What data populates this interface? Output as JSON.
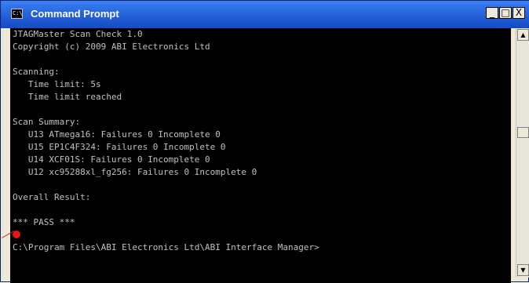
{
  "window": {
    "title": "Command Prompt",
    "icon_label": "C:\\",
    "buttons": {
      "minimize": "_",
      "maximize": "□",
      "close": "X"
    }
  },
  "console": {
    "lines": [
      "JTAGMaster Scan Check 1.0",
      "Copyright (c) 2009 ABI Electronics Ltd",
      "",
      "Scanning:",
      "   Time limit: 5s",
      "   Time limit reached",
      "",
      "Scan Summary:",
      "   U13 ATmega16: Failures 0 Incomplete 0",
      "   U15 EP1C4F324: Failures 0 Incomplete 0",
      "   U14 XCF01S: Failures 0 Incomplete 0",
      "   U12 xc95288xl_fg256: Failures 0 Incomplete 0",
      "",
      "Overall Result:",
      "",
      "*** PASS ***",
      "",
      "C:\\Program Files\\ABI Electronics Ltd\\ABI Interface Manager>"
    ]
  },
  "scrollbar": {
    "up_arrow": "▲",
    "down_arrow": "▼"
  },
  "colors": {
    "title_bar": "#2a68e0",
    "console_bg": "#000000",
    "console_text": "#c0c0c0",
    "annotation": "#e21717"
  },
  "icons": [
    "cmd-app-icon",
    "minimize-icon",
    "maximize-icon",
    "close-icon",
    "scroll-up-icon",
    "scroll-down-icon"
  ]
}
